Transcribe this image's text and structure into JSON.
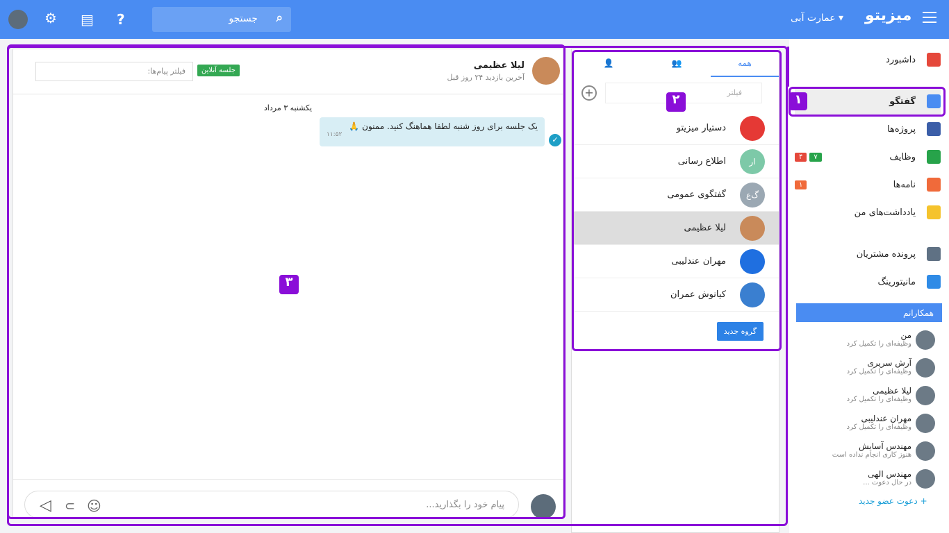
{
  "app": {
    "name": "میزیتو",
    "org": "عمارت آبی",
    "search": "جستجو"
  },
  "sidebar": {
    "items": [
      {
        "label": "داشبورد",
        "color": "#e5483b"
      },
      {
        "label": "گفتگو",
        "color": "#4a8cf2"
      },
      {
        "label": "پروژه‌ها",
        "color": "#3b5ea8"
      },
      {
        "label": "وظایف",
        "color": "#27a34a",
        "b1": "۷",
        "b2": "۴"
      },
      {
        "label": "نامه‌ها",
        "color": "#f06a3a",
        "b1": "۱"
      },
      {
        "label": "یادداشت‌های من",
        "color": "#f5c32c"
      },
      {
        "label": "پرونده مشتریان",
        "color": "#5f7184"
      },
      {
        "label": "مانیتورینگ",
        "color": "#2f8be6"
      }
    ],
    "colleagues_title": "همکارانم",
    "colleagues": [
      {
        "name": "من",
        "status": "وظیفه‌ای را تکمیل کرد"
      },
      {
        "name": "آرش سریری",
        "status": "وظیفه‌ای را تکمیل کرد"
      },
      {
        "name": "لیلا عظیمی",
        "status": "وظیفه‌ای را تکمیل کرد"
      },
      {
        "name": "مهران عندلیبی",
        "status": "وظیفه‌ای را تکمیل کرد"
      },
      {
        "name": "مهندس آسایش",
        "status": "هنوز کاری انجام نداده است"
      },
      {
        "name": "مهندس الهی",
        "status": "در حال دعوت ..."
      }
    ],
    "invite": "دعوت عضو جدید"
  },
  "chats": {
    "tab_all": "همه",
    "filter": "فیلتر",
    "items": [
      {
        "name": "دستیار میزیتو",
        "avatar": "#e53935",
        "initials": ""
      },
      {
        "name": "اطلاع رسانی",
        "avatar": "#7dc9a8",
        "initials": "ار"
      },
      {
        "name": "گفتگوی عمومی",
        "avatar": "#9ba8b3",
        "initials": "گ‌ع"
      },
      {
        "name": "لیلا عظیمی",
        "avatar": "#c98a5a",
        "initials": ""
      },
      {
        "name": "مهران عندلیبی",
        "avatar": "#1f6fe0",
        "initials": ""
      },
      {
        "name": "کیانوش عمران",
        "avatar": "#3a7fd0",
        "initials": ""
      }
    ],
    "new_group": "گروه جدید"
  },
  "conversation": {
    "name": "لیلا عظیمی",
    "last_seen": "آخرین بازدید ۲۴ روز قبل",
    "online": "جلسه آنلاین",
    "filter": "فیلتر پیام‌ها:",
    "date": "یکشنبه ۳ مرداد",
    "message": "یک جلسه برای روز شنبه لطفا هماهنگ کنید. ممنون 🙏",
    "time": "۱۱:۵۲",
    "input": "پیام خود را بگذارید..."
  },
  "markers": [
    "۱",
    "۲",
    "۳"
  ]
}
